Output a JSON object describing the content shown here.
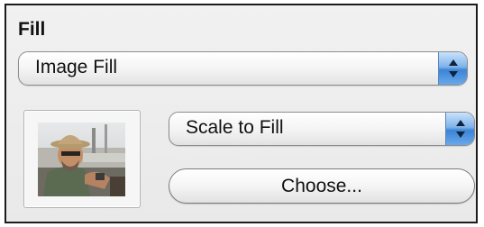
{
  "fill_panel": {
    "title": "Fill",
    "fill_type_popup": {
      "selected": "Image Fill"
    },
    "scale_popup": {
      "selected": "Scale to Fill"
    },
    "choose_button": {
      "label": "Choose..."
    },
    "image_well": {
      "icon": "photo-thumbnail"
    }
  },
  "colors": {
    "popup_arrow_accent": "#3b84d6",
    "panel_background": "#ededed"
  }
}
